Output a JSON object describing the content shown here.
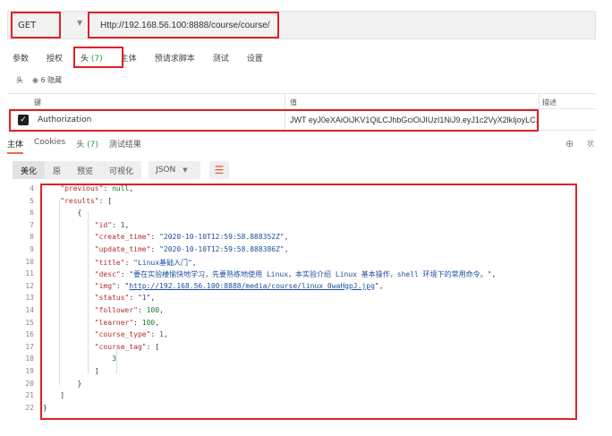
{
  "request": {
    "method": "GET",
    "url": "Http://192.168.56.100:8888/course/course/"
  },
  "request_tabs": [
    {
      "label": "参数",
      "count": ""
    },
    {
      "label": "授权",
      "count": ""
    },
    {
      "label": "头",
      "count": "(7)"
    },
    {
      "label": "主体",
      "count": ""
    },
    {
      "label": "预请求脚本",
      "count": ""
    },
    {
      "label": "测试",
      "count": ""
    },
    {
      "label": "设置",
      "count": ""
    }
  ],
  "headers_sub": {
    "label": "头",
    "hidden": "6 隐藏"
  },
  "headers_table": {
    "col_key": "键",
    "col_value": "值",
    "col_desc": "描述",
    "row": {
      "key": "Authorization",
      "value": "JWT eyJ0eXAiOiJKV1QiLCJhbGciOiJIUzI1NiJ9.eyJ1c2VyX2lkIjoyLC..."
    }
  },
  "response_tabs": [
    {
      "label": "主体",
      "count": ""
    },
    {
      "label": "Cookies",
      "count": ""
    },
    {
      "label": "头",
      "count": "(7)"
    },
    {
      "label": "测试结果",
      "count": ""
    }
  ],
  "status_label": "状",
  "view_buttons": [
    "美化",
    "原",
    "预览",
    "可视化"
  ],
  "format": "JSON",
  "code_lines": [
    {
      "n": "4",
      "t": "    \"previous\": null,"
    },
    {
      "n": "5",
      "t": "    \"results\": ["
    },
    {
      "n": "6",
      "t": "        {"
    },
    {
      "n": "7",
      "t": "            \"id\": 1,"
    },
    {
      "n": "8",
      "t": "            \"create_time\": \"2020-10-10T12:59:58.888352Z\","
    },
    {
      "n": "9",
      "t": "            \"update_time\": \"2020-10-10T12:59:58.888386Z\","
    },
    {
      "n": "10",
      "t": "            \"title\": \"Linux基础入门\","
    },
    {
      "n": "11",
      "t": "            \"desc\": \"要在实验楼愉快地学习，先要熟练地使用 Linux，本实验介绍 Linux 基本操作，shell 环境下的常用命令。\","
    },
    {
      "n": "12",
      "t": "            \"img\": \"http://192.168.56.100:8888/media/course/linux_0waHgpJ.jpg\","
    },
    {
      "n": "13",
      "t": "            \"status\": \"1\","
    },
    {
      "n": "14",
      "t": "            \"follower\": 100,"
    },
    {
      "n": "15",
      "t": "            \"learner\": 100,"
    },
    {
      "n": "16",
      "t": "            \"course_type\": 1,"
    },
    {
      "n": "17",
      "t": "            \"course_tag\": ["
    },
    {
      "n": "18",
      "t": "                3"
    },
    {
      "n": "19",
      "t": "            ]"
    },
    {
      "n": "20",
      "t": "        }"
    },
    {
      "n": "21",
      "t": "    ]"
    },
    {
      "n": "22",
      "t": "}"
    }
  ],
  "accent": {
    "red_box": "#e0202a",
    "active_tab": "#f26b3a",
    "count_green": "#2a9d3c"
  }
}
